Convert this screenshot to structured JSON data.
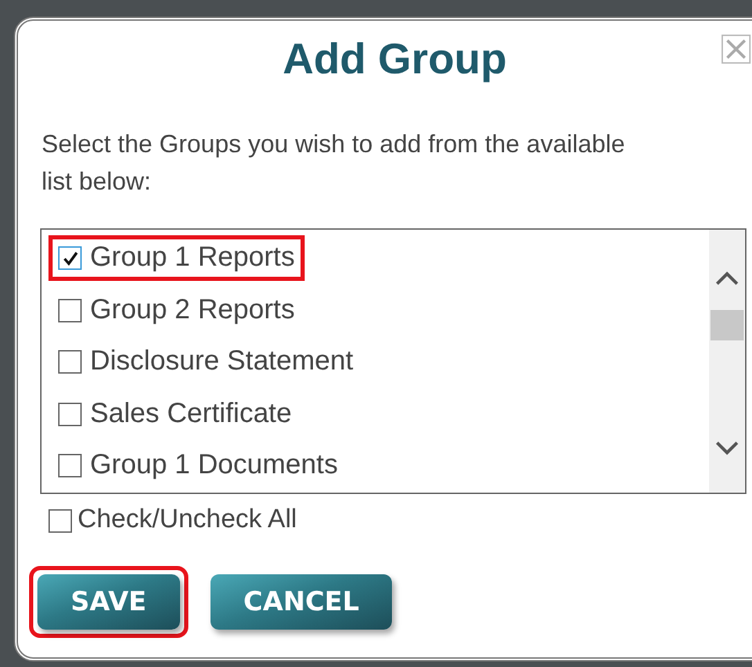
{
  "dialog": {
    "title": "Add Group",
    "instructions": "Select the Groups you wish to add from the available list below:"
  },
  "groups": [
    {
      "label": "Group 1 Reports",
      "checked": true,
      "highlighted": true
    },
    {
      "label": "Group 2 Reports",
      "checked": false,
      "highlighted": false
    },
    {
      "label": "Disclosure Statement",
      "checked": false,
      "highlighted": false
    },
    {
      "label": "Sales Certificate",
      "checked": false,
      "highlighted": false
    },
    {
      "label": "Group 1 Documents",
      "checked": false,
      "highlighted": false
    }
  ],
  "check_all": {
    "label": "Check/Uncheck All",
    "checked": false
  },
  "buttons": [
    {
      "label": "SAVE",
      "highlighted": true
    },
    {
      "label": "CANCEL",
      "highlighted": false
    }
  ]
}
